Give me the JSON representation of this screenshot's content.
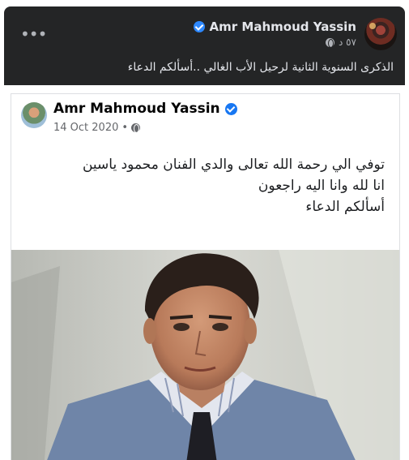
{
  "post": {
    "author": "Amr Mahmoud Yassin",
    "time": "٥٧ د",
    "caption": "الذكرى السنوية الثانية لرحيل الأب الغالي ..أسألكم الدعاء",
    "more_label": "•••"
  },
  "shared_post": {
    "author": "Amr Mahmoud Yassin",
    "date": "14 Oct 2020",
    "lines": [
      "توفي الي رحمة  الله تعالى والدي الفنان محمود ياسين",
      "انا لله وانا اليه راجعون",
      "أسألكم  الدعاء"
    ]
  },
  "colors": {
    "post_background": "#242526",
    "verified_badge": "#2d88ff",
    "shared_background": "#ffffff"
  },
  "icons": [
    "more-icon",
    "verified-icon",
    "globe-icon",
    "avatar"
  ]
}
